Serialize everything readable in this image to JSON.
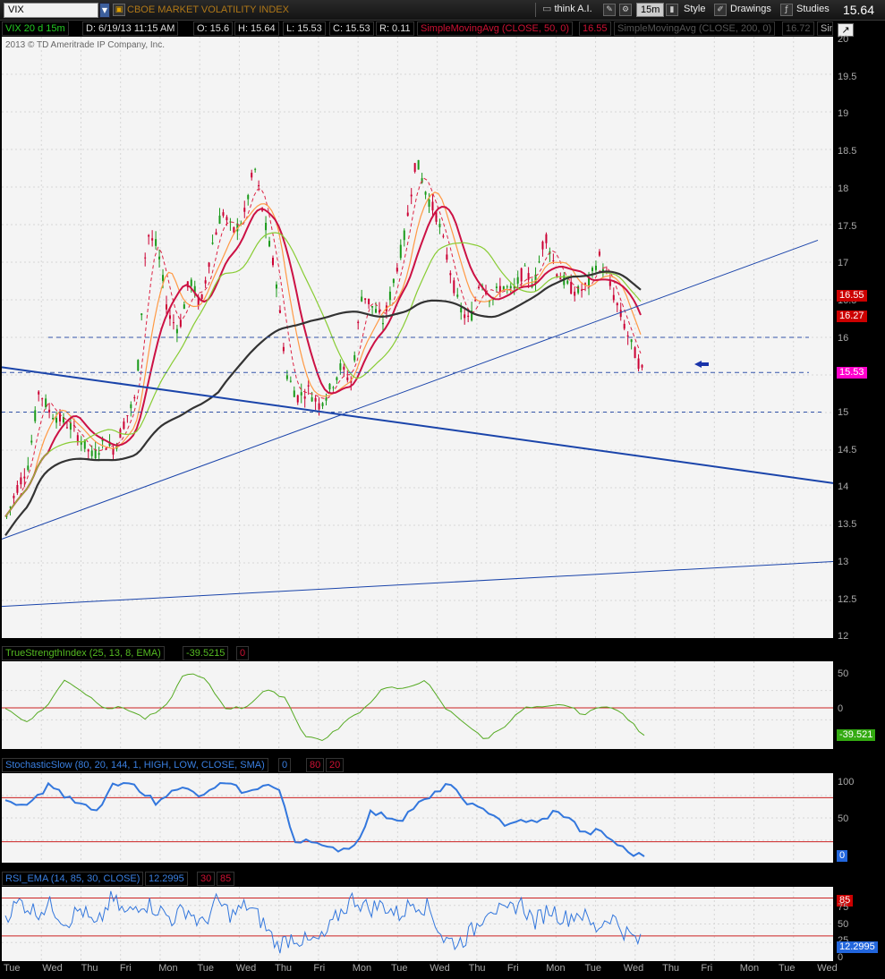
{
  "toolbar": {
    "symbol": "VIX",
    "description": "CBOE MARKET VOLATILITY INDEX",
    "think_ai": "think A.I.",
    "aggregation": "15m",
    "style": "Style",
    "drawings": "Drawings",
    "studies": "Studies",
    "last_price": "15.64"
  },
  "infobar": {
    "symbol_period": "VIX 20 d 15m",
    "date": "D: 6/19/13 11:15 AM",
    "open": "O: 15.6",
    "high": "H: 15.64",
    "low": "L: 15.53",
    "close": "C: 15.53",
    "range": "R: 0.11",
    "sma50_label": "SimpleMovingAvg (CLOSE, 50, 0)",
    "sma50_value": "16.55",
    "sma200_label": "SimpleMovingAvg (CLOSE, 200, 0)",
    "sma200_value": "16.72",
    "overflow": "Sim"
  },
  "copyright": "2013 © TD Ameritrade IP Company, Inc.",
  "price_axis": {
    "ticks": [
      "20",
      "19.5",
      "19",
      "18.5",
      "18",
      "17.5",
      "17",
      "16.5",
      "16",
      "15.5",
      "15",
      "14.5",
      "14",
      "13.5",
      "13",
      "12.5",
      "12"
    ],
    "tags": [
      {
        "text": "16.55",
        "color": "#cc0000"
      },
      {
        "text": "16.27",
        "color": "#cc0000"
      },
      {
        "text": "15.53",
        "color": "#ff00cc"
      }
    ]
  },
  "tsi": {
    "label": "TrueStrengthIndex (25, 13, 8, EMA)",
    "value": "-39.5215",
    "zero": "0",
    "ticks": [
      "50",
      "0"
    ],
    "tag": "-39.521"
  },
  "stoch": {
    "label": "StochasticSlow (80, 20, 144, 1, HIGH, LOW, CLOSE, SMA)",
    "v1": "0",
    "v2": "80",
    "v3": "20",
    "ticks": [
      "100",
      "50"
    ],
    "tag": "0"
  },
  "rsi": {
    "label": "RSI_EMA (14, 85, 30, CLOSE)",
    "value": "12.2995",
    "v1": "30",
    "v2": "85",
    "ticks": [
      "75",
      "50",
      "25",
      "0"
    ],
    "tag_85": "85",
    "tag": "12.2995"
  },
  "time_axis": [
    "Tue",
    "Wed",
    "Thu",
    "Fri",
    "Mon",
    "Tue",
    "Wed",
    "Thu",
    "Fri",
    "Mon",
    "Tue",
    "Wed",
    "Thu",
    "Fri",
    "Mon",
    "Tue",
    "Wed",
    "Thu",
    "Fri",
    "Mon",
    "Tue",
    "Wed"
  ],
  "colors": {
    "price_up": "#1a9a1a",
    "price_down": "#cc0033",
    "sma50": "#cc1144",
    "sma200": "#333333",
    "trendline": "#1a44aa",
    "tsi_line": "#55aa22",
    "stoch_line": "#3377dd",
    "rsi_line": "#3377dd"
  }
}
